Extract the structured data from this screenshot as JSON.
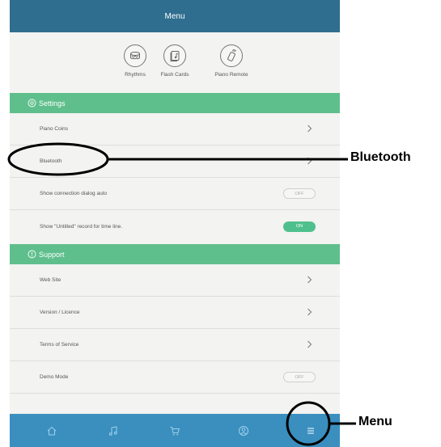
{
  "header": {
    "title": "Menu"
  },
  "quick_actions": [
    {
      "label": "Rhythms",
      "icon": "drum-icon"
    },
    {
      "label": "Flash Cards",
      "icon": "flash-cards-icon"
    },
    {
      "label": "Piano Remote",
      "icon": "remote-icon"
    }
  ],
  "settings": {
    "title": "Settings",
    "rows": [
      {
        "label": "Piano Coins",
        "control": "chevron"
      },
      {
        "label": "Bluetooth",
        "control": "chevron"
      },
      {
        "label": "Show connection dialog auto",
        "control": "toggle",
        "value": "OFF"
      },
      {
        "label": "Show \"Untitled\" record for time line.",
        "control": "toggle",
        "value": "ON"
      }
    ]
  },
  "support": {
    "title": "Support",
    "rows": [
      {
        "label": "Web Site",
        "control": "chevron"
      },
      {
        "label": "Version / Licence",
        "control": "chevron"
      },
      {
        "label": "Terms of Service",
        "control": "chevron"
      },
      {
        "label": "Demo Mode",
        "control": "toggle",
        "value": "OFF"
      }
    ]
  },
  "bottom_nav": [
    {
      "icon": "home-icon"
    },
    {
      "icon": "music-note-icon"
    },
    {
      "icon": "cart-icon"
    },
    {
      "icon": "account-icon"
    },
    {
      "icon": "menu-icon"
    }
  ],
  "annotations": {
    "bluetooth": "Bluetooth",
    "menu": "Menu"
  },
  "colors": {
    "header": "#2f6e8f",
    "section": "#5fbf8c",
    "bottom_bar": "#3a8fbf",
    "toggle_on": "#4fc08d"
  }
}
